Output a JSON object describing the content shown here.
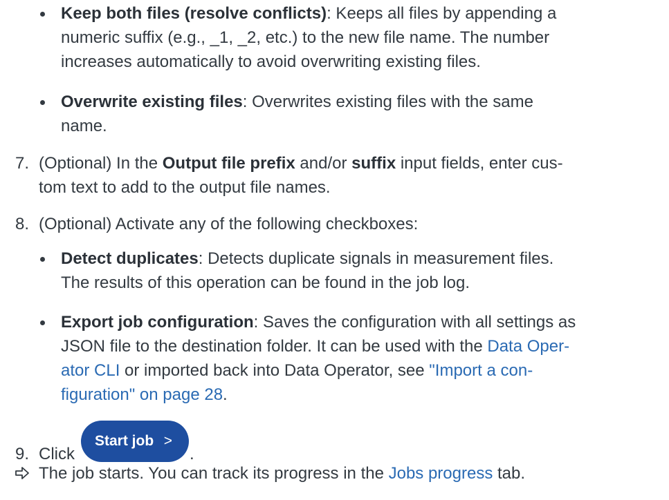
{
  "bullets_top": [
    {
      "bold": "Keep both files (resolve conflicts)",
      "lines": [
        ": Keeps all files by appending a",
        "numeric suffix (e.g., _1, _2, etc.) to the new file name. The number",
        "increases automatically to avoid overwriting existing files."
      ]
    },
    {
      "bold": "Overwrite existing files",
      "lines": [
        ": Overwrites existing files with the same",
        "name."
      ]
    }
  ],
  "step7": {
    "num": "7.",
    "pre": "(Optional) In the ",
    "bold1": "Output file prefix",
    "mid": " and/or ",
    "bold2": "suffix",
    "post": " input fields, enter cus-",
    "line2": "tom text to add to the output file names."
  },
  "step8": {
    "num": "8.",
    "text": "(Optional) Activate any of the following checkboxes:"
  },
  "bullet_detect": {
    "bold": "Detect duplicates",
    "line1": ": Detects duplicate signals in measurement files.",
    "line2": "The results of this operation can be found in the job log."
  },
  "bullet_export": {
    "bold": "Export job configuration",
    "line1": ": Saves the configuration with all settings as",
    "line2_pre": "JSON file to the destination folder. It can be used with the ",
    "line2_link": "Data Oper-",
    "line3_link": "ator CLI",
    "line3_mid": " or imported back into Data Operator, see ",
    "line3_link2": "\"Import a con-",
    "line4_link": "figuration\" on page 28",
    "line4_post": "."
  },
  "step9": {
    "num": "9.",
    "text": "Click",
    "after": ".",
    "button_label": "Start job",
    "button_chevron": ">"
  },
  "result": {
    "pre": "The job starts. You can track its progress in the ",
    "link": "Jobs progress",
    "post": " tab."
  },
  "colors": {
    "text": "#333a41",
    "link": "#2a6ab3",
    "button": "#1e4ea0"
  },
  "icons": {
    "result_marker": "hollow-right-arrow-icon"
  }
}
